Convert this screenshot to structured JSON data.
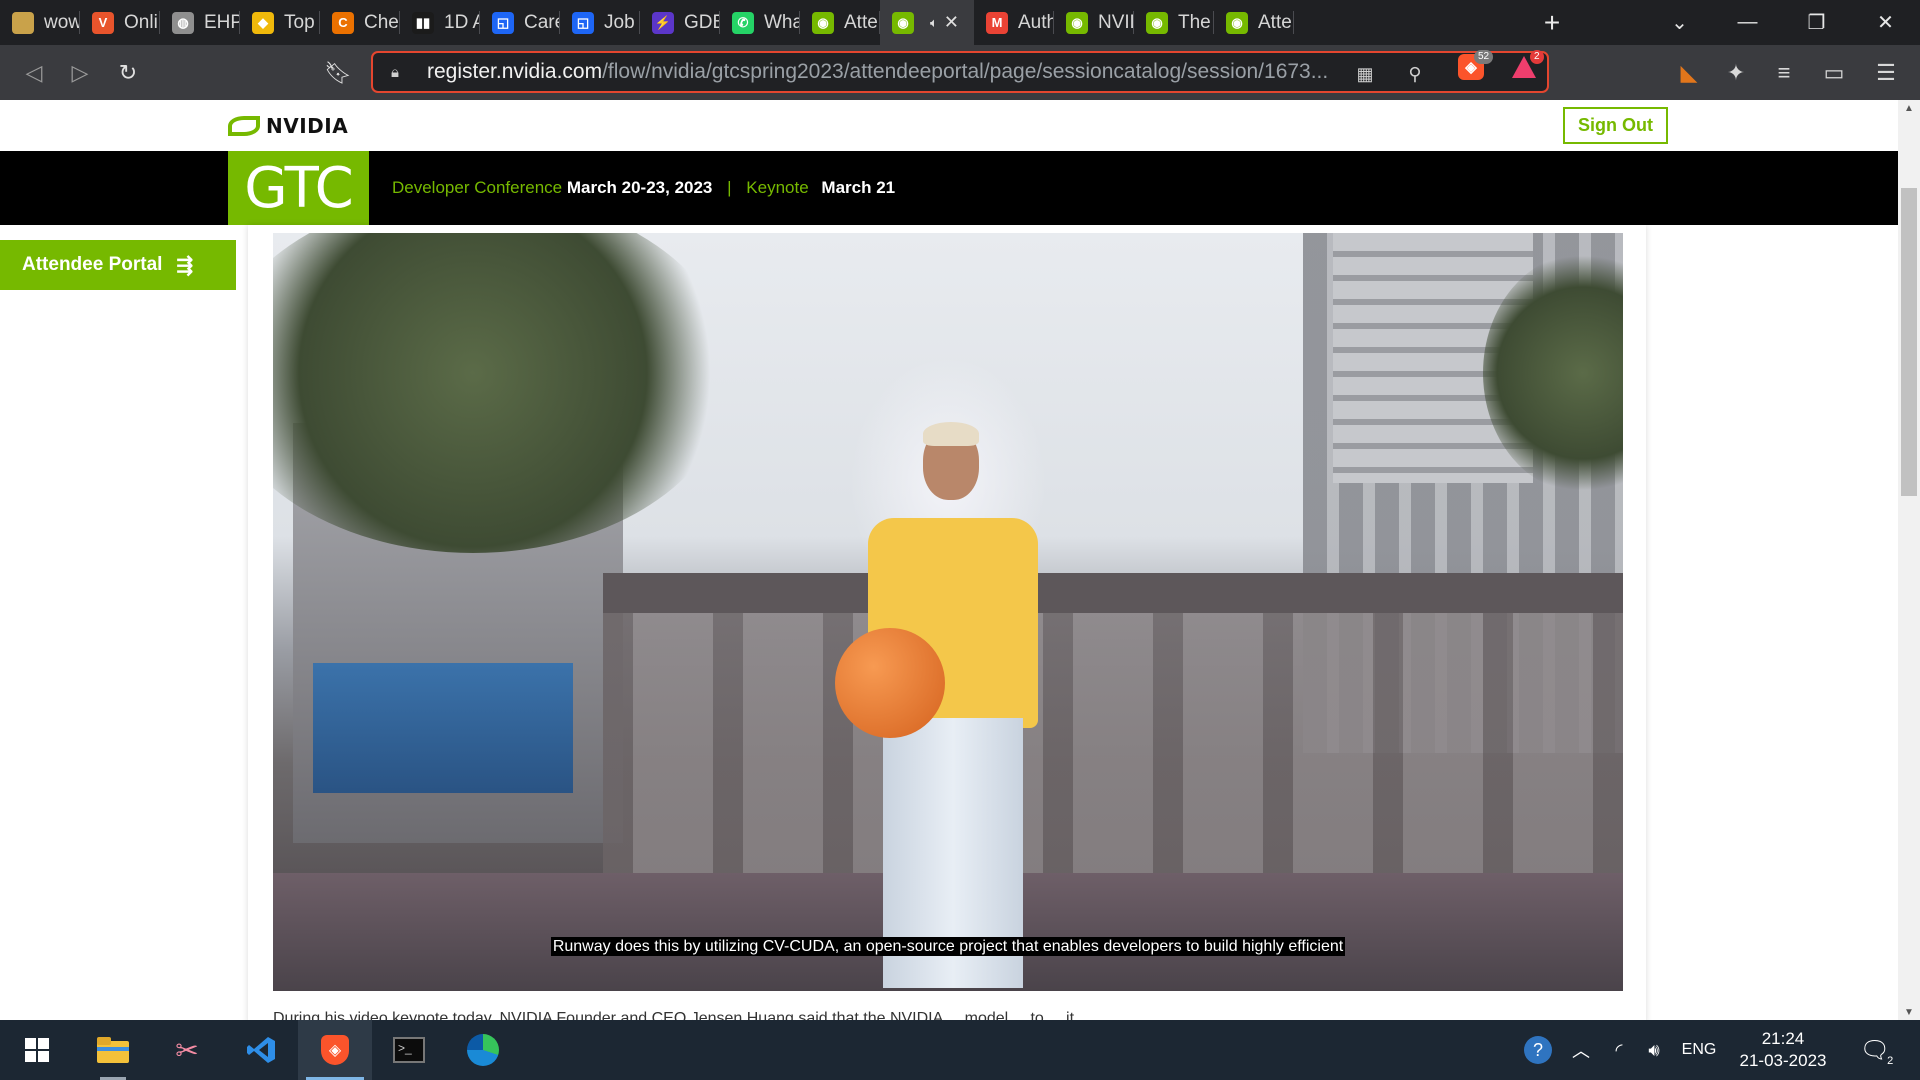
{
  "browser": {
    "tabs": [
      {
        "title": "wow!",
        "favicon": "doge-icon",
        "color": "#c9a24a"
      },
      {
        "title": "Online",
        "favicon": "vivaldi-icon",
        "color": "#e8542c",
        "glyph": "V"
      },
      {
        "title": "EHPD",
        "favicon": "globe-icon",
        "color": "#8f8f8f",
        "glyph": "◍"
      },
      {
        "title": "Top C",
        "favicon": "binance-icon",
        "color": "#f0b90b",
        "glyph": "◆"
      },
      {
        "title": "Chegg",
        "favicon": "chegg-icon",
        "color": "#eb7100",
        "glyph": "C"
      },
      {
        "title": "1D A",
        "favicon": "bars-icon",
        "color": "#1b1b1b",
        "glyph": "▮▮"
      },
      {
        "title": "Career",
        "favicon": "square-icon",
        "color": "#1e66f5",
        "glyph": "◱"
      },
      {
        "title": "Job C",
        "favicon": "square-icon",
        "color": "#1e66f5",
        "glyph": "◱"
      },
      {
        "title": "GDB",
        "favicon": "bolt-icon",
        "color": "#5b36c9",
        "glyph": "⚡"
      },
      {
        "title": "WhatsApp",
        "favicon": "whatsapp-icon",
        "color": "#25d366",
        "glyph": "✆"
      },
      {
        "title": "Atten",
        "favicon": "nvidia-icon",
        "color": "#76b900",
        "glyph": "◉"
      },
      {
        "title": "",
        "favicon": "nvidia-icon",
        "color": "#76b900",
        "glyph": "◉",
        "active": true
      },
      {
        "title": "Auth",
        "favicon": "gmail-icon",
        "color": "#ea4335",
        "glyph": "M"
      },
      {
        "title": "NVID",
        "favicon": "nvidia-icon",
        "color": "#76b900",
        "glyph": "◉"
      },
      {
        "title": "The #",
        "favicon": "nvidia-icon",
        "color": "#76b900",
        "glyph": "◉"
      },
      {
        "title": "Atten",
        "favicon": "nvidia-icon",
        "color": "#76b900",
        "glyph": "◉"
      }
    ],
    "url_host": "register.nvidia.com",
    "url_path": "/flow/nvidia/gtcspring2023/attendeeportal/page/sessioncatalog/session/1673...",
    "brave_shields_count": "52",
    "rewards_count": "2"
  },
  "page": {
    "brand": "NVIDIA",
    "sign_out": "Sign Out",
    "gtc_logo": "GTC",
    "dev_conf_label": "Developer Conference",
    "dev_conf_dates": "March 20-23, 2023",
    "keynote_label": "Keynote",
    "keynote_date": "March 21",
    "attendee_portal": "Attendee Portal",
    "video_caption": "Runway does this by utilizing CV-CUDA, an open-source project that enables developers to build highly efficient",
    "below_text": "During his video keynote today, NVIDIA Founder and CEO Jensen Huang said that the NVIDIA ... model ... to ... it..."
  },
  "taskbar": {
    "language": "ENG",
    "time": "21:24",
    "date": "21-03-2023",
    "notifications": "2"
  },
  "colors": {
    "nvidia_green": "#76b900",
    "brave_orange": "#fb542b",
    "taskbar_bg": "#1c2733"
  }
}
